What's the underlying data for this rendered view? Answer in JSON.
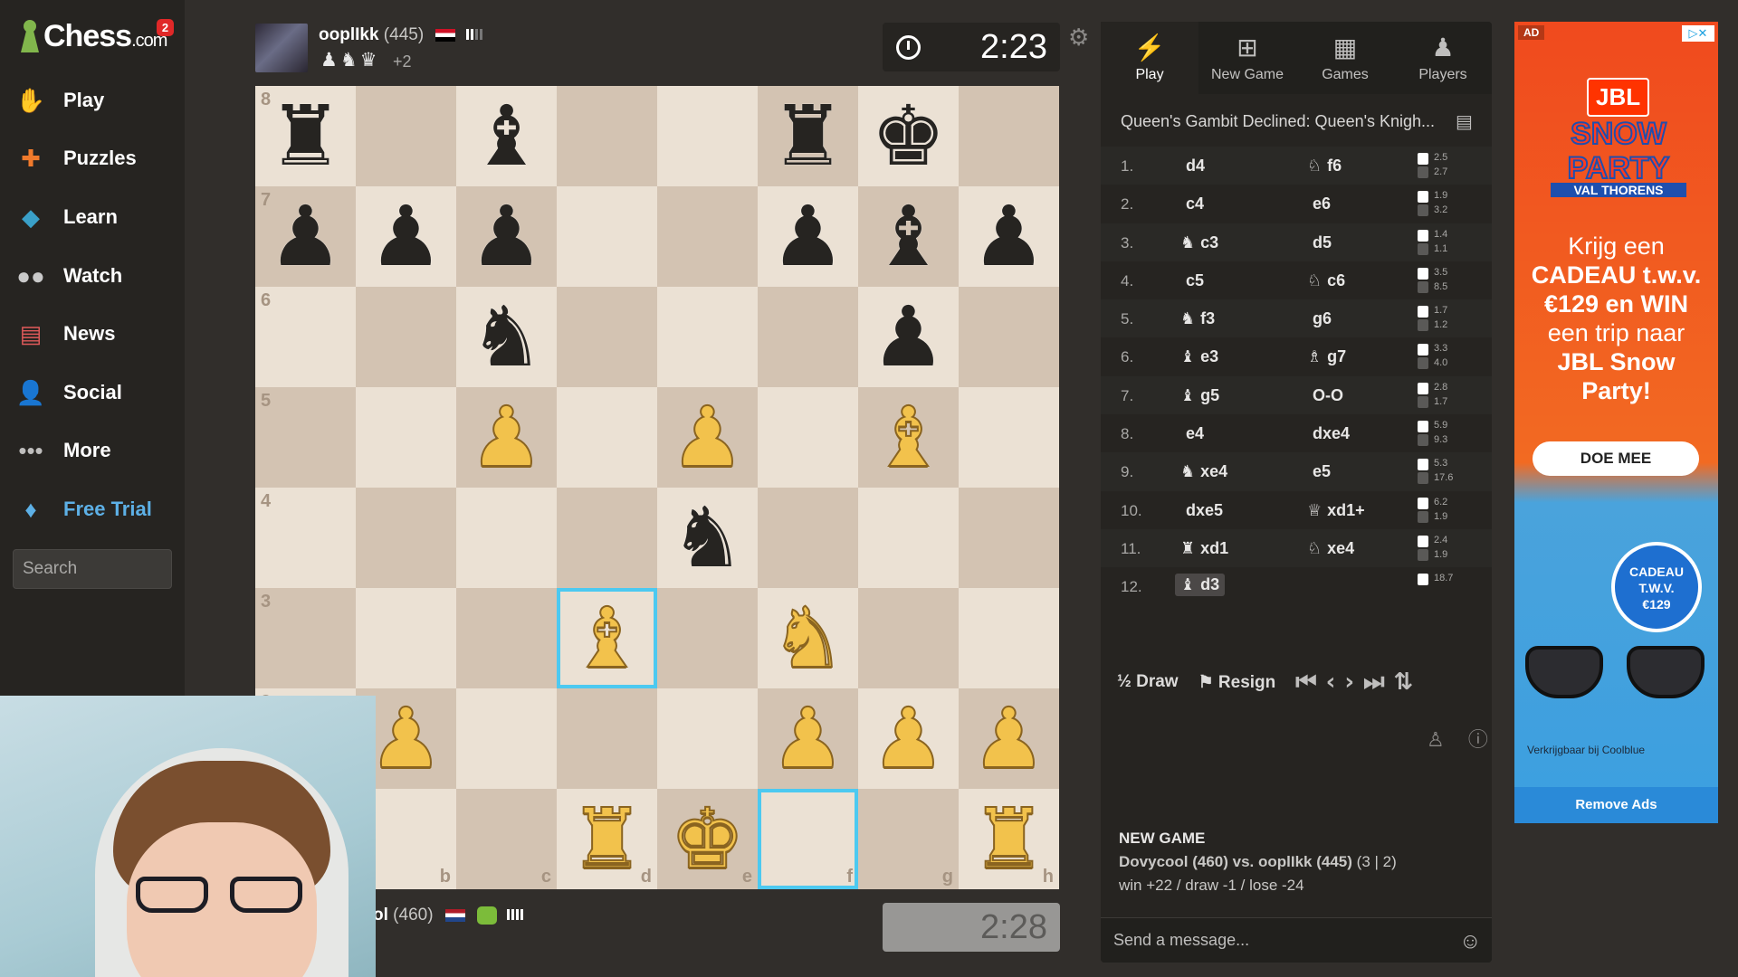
{
  "app": {
    "logo_text": "Chess",
    "logo_suffix": ".com",
    "notification_count": "2"
  },
  "sidebar": {
    "items": [
      {
        "label": "Play",
        "icon": "play-hand-icon"
      },
      {
        "label": "Puzzles",
        "icon": "puzzle-icon"
      },
      {
        "label": "Learn",
        "icon": "graduation-cap-icon"
      },
      {
        "label": "Watch",
        "icon": "binoculars-icon"
      },
      {
        "label": "News",
        "icon": "newspaper-icon"
      },
      {
        "label": "Social",
        "icon": "people-icon"
      },
      {
        "label": "More",
        "icon": "more-dots-icon"
      },
      {
        "label": "Free Trial",
        "icon": "diamond-icon"
      }
    ],
    "search_placeholder": "Search"
  },
  "top_player": {
    "name": "ooplIkk",
    "rating": "(445)",
    "captured": "♟♞♛",
    "advantage": "+2",
    "clock": "2:23"
  },
  "bottom_player": {
    "name": "ol",
    "rating": "(460)",
    "clock": "2:28"
  },
  "board": {
    "files": [
      "a",
      "b",
      "c",
      "d",
      "e",
      "f",
      "g",
      "h"
    ],
    "ranks": [
      "8",
      "7",
      "6",
      "5",
      "4",
      "3",
      "2",
      "1"
    ],
    "position": [
      [
        "bR",
        "",
        "bB",
        "",
        "",
        "bR",
        "bK",
        ""
      ],
      [
        "bP",
        "bP",
        "bP",
        "",
        "",
        "bP",
        "bB",
        "bP"
      ],
      [
        "",
        "",
        "bN",
        "",
        "",
        "",
        "bP",
        ""
      ],
      [
        "",
        "",
        "wP",
        "",
        "wP",
        "",
        "wB",
        ""
      ],
      [
        "",
        "",
        "",
        "",
        "bN",
        "",
        "",
        ""
      ],
      [
        "",
        "",
        "",
        "wB",
        "",
        "wN",
        "",
        ""
      ],
      [
        "",
        "wP",
        "",
        "",
        "",
        "wP",
        "wP",
        "wP"
      ],
      [
        "",
        "",
        "",
        "wR",
        "wK",
        "",
        "",
        "wR"
      ]
    ],
    "highlights": [
      "d3",
      "f1"
    ]
  },
  "panel": {
    "tabs": [
      {
        "label": "Play",
        "icon": "lightning-icon",
        "active": true
      },
      {
        "label": "New Game",
        "icon": "plus-square-icon",
        "active": false
      },
      {
        "label": "Games",
        "icon": "checkerboard-icon",
        "active": false
      },
      {
        "label": "Players",
        "icon": "players-icon",
        "active": false
      }
    ],
    "opening": "Queen's Gambit Declined: Queen's Knigh...",
    "moves": [
      {
        "num": "1.",
        "w_fig": "",
        "w": "d4",
        "b_fig": "♘",
        "b": "f6",
        "tw": "2.5",
        "tb": "2.7"
      },
      {
        "num": "2.",
        "w_fig": "",
        "w": "c4",
        "b_fig": "",
        "b": "e6",
        "tw": "1.9",
        "tb": "3.2"
      },
      {
        "num": "3.",
        "w_fig": "♞",
        "w": "c3",
        "b_fig": "",
        "b": "d5",
        "tw": "1.4",
        "tb": "1.1"
      },
      {
        "num": "4.",
        "w_fig": "",
        "w": "c5",
        "b_fig": "♘",
        "b": "c6",
        "tw": "3.5",
        "tb": "8.5"
      },
      {
        "num": "5.",
        "w_fig": "♞",
        "w": "f3",
        "b_fig": "",
        "b": "g6",
        "tw": "1.7",
        "tb": "1.2"
      },
      {
        "num": "6.",
        "w_fig": "♝",
        "w": "e3",
        "b_fig": "♗",
        "b": "g7",
        "tw": "3.3",
        "tb": "4.0"
      },
      {
        "num": "7.",
        "w_fig": "♝",
        "w": "g5",
        "b_fig": "",
        "b": "O-O",
        "tw": "2.8",
        "tb": "1.7"
      },
      {
        "num": "8.",
        "w_fig": "",
        "w": "e4",
        "b_fig": "",
        "b": "dxe4",
        "tw": "5.9",
        "tb": "9.3"
      },
      {
        "num": "9.",
        "w_fig": "♞",
        "w": "xe4",
        "b_fig": "",
        "b": "e5",
        "tw": "5.3",
        "tb": "17.6"
      },
      {
        "num": "10.",
        "w_fig": "",
        "w": "dxe5",
        "b_fig": "♕",
        "b": "xd1+",
        "tw": "6.2",
        "tb": "1.9"
      },
      {
        "num": "11.",
        "w_fig": "♜",
        "w": "xd1",
        "b_fig": "♘",
        "b": "xe4",
        "tw": "2.4",
        "tb": "1.9"
      },
      {
        "num": "12.",
        "w_fig": "♝",
        "w": "d3",
        "b_fig": "",
        "b": "",
        "tw": "18.7",
        "tb": ""
      }
    ],
    "controls": {
      "draw": "½ Draw",
      "resign": "⚑ Resign"
    },
    "new_game": {
      "title": "NEW GAME",
      "players": "Dovycool (460) vs. ooplIkk (445)",
      "time": "(3 | 2)",
      "odds": "win +22 / draw -1 / lose -24"
    },
    "message_placeholder": "Send a message..."
  },
  "ad": {
    "tag": "AD",
    "brand": "JBL",
    "headline": "SNOW PARTY",
    "subline": "VAL THORENS",
    "copy_1": "Krijg een",
    "copy_2": "CADEAU t.w.v.",
    "copy_3": "€129 en WIN",
    "copy_4": "een trip naar",
    "copy_5": "JBL Snow",
    "copy_6": "Party!",
    "cta": "DOE MEE",
    "badge_1": "CADEAU",
    "badge_2": "T.W.V.",
    "badge_3": "€129",
    "small": "Verkrijgbaar bij Coolblue",
    "remove": "Remove Ads"
  }
}
